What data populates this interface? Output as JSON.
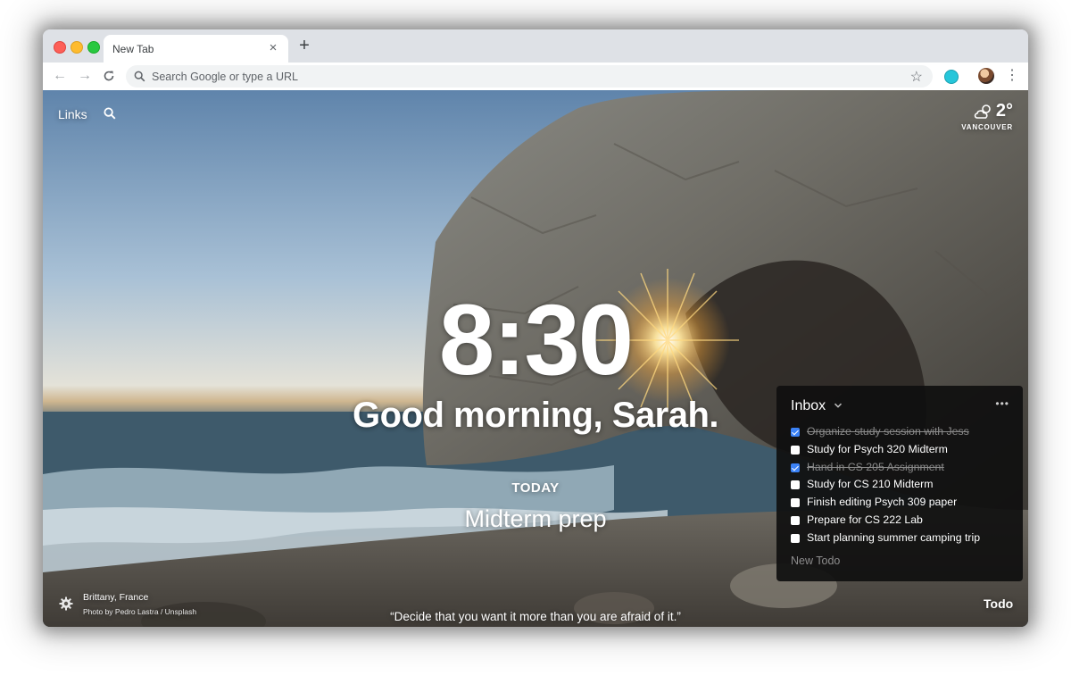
{
  "browser": {
    "tab_title": "New Tab",
    "omnibox_placeholder": "Search Google or type a URL"
  },
  "header": {
    "links_label": "Links"
  },
  "weather": {
    "temperature": "2°",
    "location": "VANCOUVER",
    "icon": "partly-cloudy-icon"
  },
  "main": {
    "time": "8:30",
    "greeting": "Good morning, Sarah.",
    "focus_label": "TODAY",
    "focus_text": "Midterm prep"
  },
  "quote": "“Decide that you want it more than you are afraid of it.”",
  "photo": {
    "location": "Brittany, France",
    "credit": "Photo by Pedro Lastra / Unsplash"
  },
  "todo": {
    "toggle_label": "Todo",
    "list_name": "Inbox",
    "new_placeholder": "New Todo",
    "items": [
      {
        "text": "Organize study session with Jess",
        "done": true
      },
      {
        "text": "Study for Psych 320 Midterm",
        "done": false
      },
      {
        "text": "Hand in CS 205 Assignment",
        "done": true
      },
      {
        "text": "Study for CS 210 Midterm",
        "done": false
      },
      {
        "text": "Finish editing Psych 309 paper",
        "done": false
      },
      {
        "text": "Prepare for CS 222 Lab",
        "done": false
      },
      {
        "text": "Start planning summer camping trip",
        "done": false
      }
    ]
  }
}
